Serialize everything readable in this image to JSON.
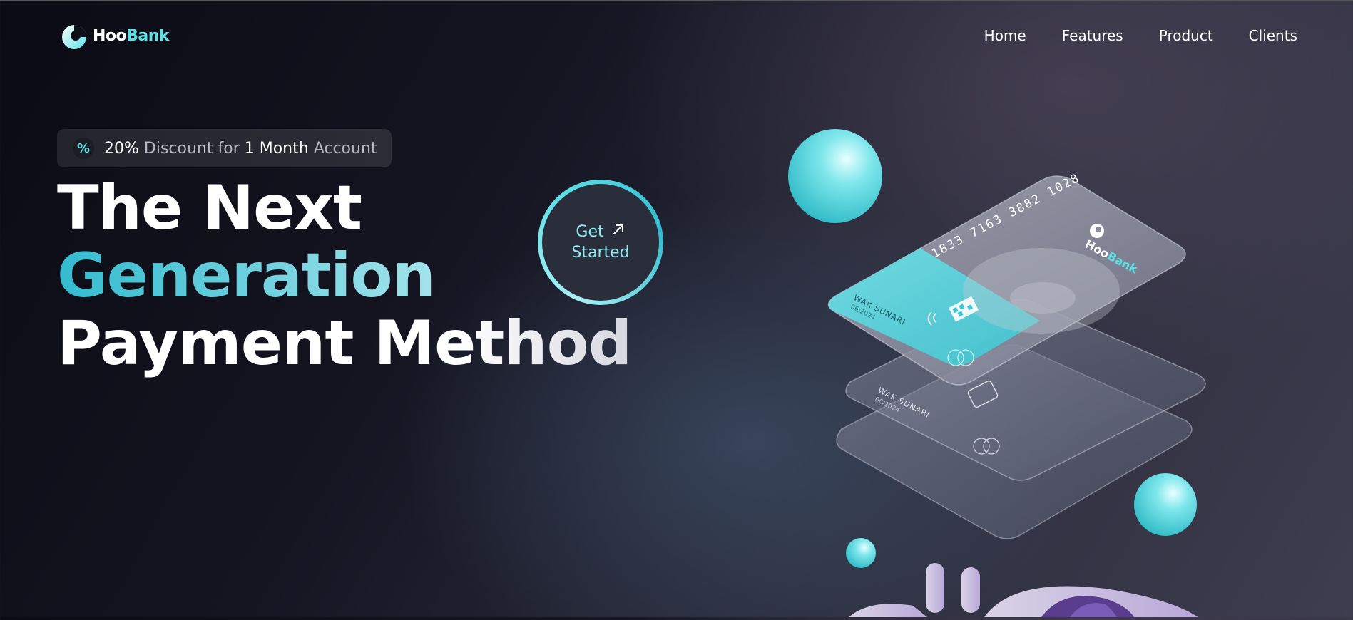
{
  "brand": {
    "name_part1": "Hoo",
    "name_part2": "Bank",
    "accent": "#5ce1e6"
  },
  "nav": {
    "items": [
      {
        "label": "Home"
      },
      {
        "label": "Features"
      },
      {
        "label": "Product"
      },
      {
        "label": "Clients"
      }
    ]
  },
  "promo": {
    "icon": "percent-icon",
    "value": "20%",
    "text1": "Discount for",
    "highlight": "1 Month",
    "text2": "Account"
  },
  "hero": {
    "line1": "The Next",
    "line2": "Generation",
    "line3": "Payment Method"
  },
  "cta": {
    "line1": "Get",
    "line2": "Started",
    "icon": "arrow-up-right-icon"
  },
  "card": {
    "number": "1833 7163 3882 1028",
    "holder": "WAK SUNARI",
    "expiry": "06/2024",
    "brand_part1": "Hoo",
    "brand_part2": "Bank"
  },
  "colors": {
    "cyan": "#5ce1e6",
    "dark": "#0b0b14"
  }
}
